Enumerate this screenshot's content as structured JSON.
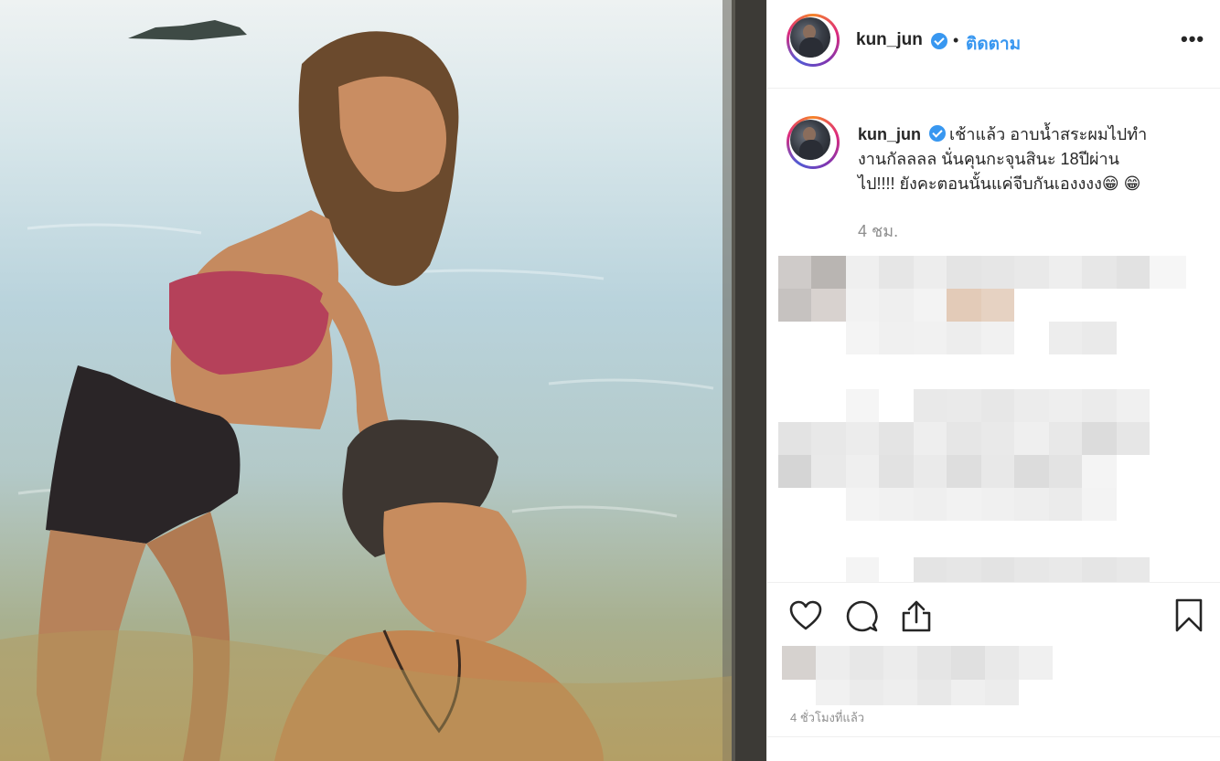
{
  "post": {
    "username": "kun_jun",
    "follow_label": "ติดตาม",
    "separator": "•",
    "more_label": "•••",
    "caption_user": "kun_jun",
    "caption_line1": "เช้าแล้ว อาบน้ำสระผมไปทำ",
    "caption_line2": "งานกัลลลล นั่นคุนกะจุนสินะ 18ปีผ่าน",
    "caption_line3": "ไป!!!! ยังคะตอนนั้นแค่จีบกันเองงงง😁 😁",
    "caption_time": "4 ชม.",
    "timestamp": "4 ชั่วโมงที่แล้ว"
  },
  "icons": {
    "like": "heart-icon",
    "comment": "comment-icon",
    "share": "share-icon",
    "save": "bookmark-icon",
    "verified": "verified-badge-icon"
  },
  "colors": {
    "accent": "#3897f0",
    "text": "#262626",
    "muted": "#8e8e8e",
    "border": "#efefef"
  }
}
